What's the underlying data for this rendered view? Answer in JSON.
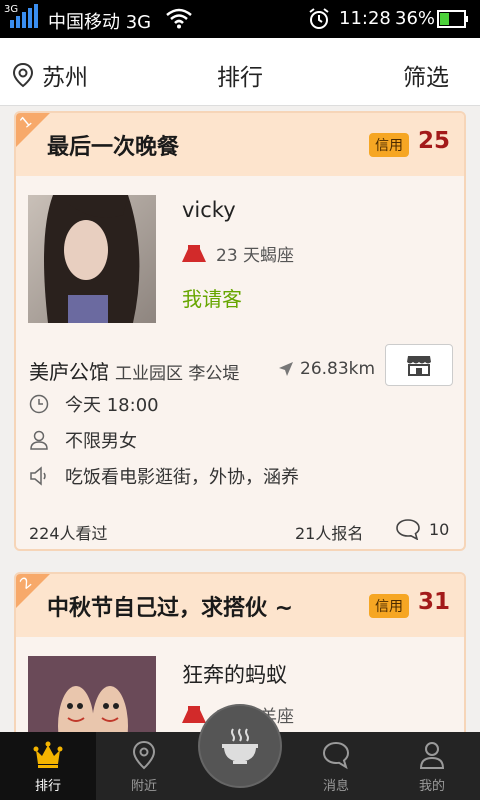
{
  "status_bar": {
    "network_tag": "3G",
    "carrier": "中国移动 3G",
    "time": "11:28",
    "battery": "36%"
  },
  "header": {
    "location": "苏州",
    "title": "排行",
    "filter": "筛选"
  },
  "cards": [
    {
      "rank": "1",
      "title": "最后一次晚餐",
      "credit_label": "信用",
      "credit_score": "25",
      "user_name": "vicky",
      "age_sign": "23 天蝎座",
      "pay_type": "我请客",
      "venue": "美庐公馆",
      "area": "工业园区 李公堤",
      "distance": "26.83km",
      "time": "今天 18:00",
      "gender": "不限男女",
      "activity": "吃饭看电影逛街，外协，涵养",
      "views": "224人看过",
      "signups": "21人报名",
      "comments": "10"
    },
    {
      "rank": "2",
      "title": "中秋节自己过，求搭伙 ~",
      "credit_label": "信用",
      "credit_score": "31",
      "user_name": "狂奔的蚂蚁",
      "age_sign": "25 白羊座"
    }
  ],
  "bottom_nav": {
    "items": [
      {
        "label": "排行",
        "icon": "crown-icon",
        "active": true
      },
      {
        "label": "附近",
        "icon": "location-pin-icon",
        "active": false
      },
      {
        "label": "消息",
        "icon": "chat-bubble-icon",
        "active": false
      },
      {
        "label": "我的",
        "icon": "person-icon",
        "active": false
      }
    ],
    "center_icon": "rice-bowl-icon"
  },
  "colors": {
    "accent_orange": "#f6a623",
    "score_red": "#a31a1a",
    "treat_green": "#66a600",
    "card_head": "#fde4cd",
    "card_body": "#faf3ee"
  }
}
